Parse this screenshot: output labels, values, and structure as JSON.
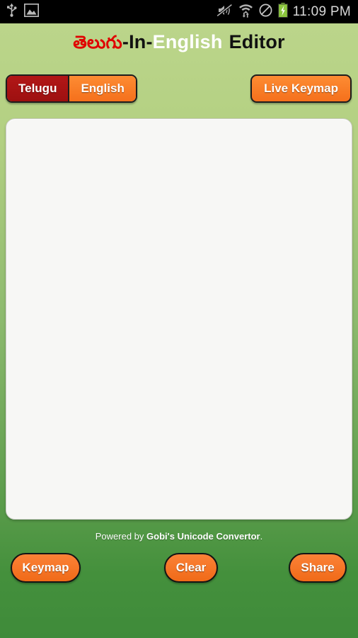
{
  "status_bar": {
    "icons_left": [
      "usb-icon",
      "screenshot-image-icon"
    ],
    "icons_right": [
      "mute-vibrate-icon",
      "wifi-data-transfer-icon",
      "do-not-disturb-icon",
      "battery-charging-icon"
    ],
    "time": "11:09 PM",
    "background": "#000000",
    "text_color": "#d8d8d8"
  },
  "app": {
    "title_parts": {
      "telugu": "తెలుగు",
      "dash_in": "-In-",
      "english": "English",
      "editor": "Editor"
    },
    "title_colors": {
      "telugu": "#e00000",
      "dash_in": "#111111",
      "english": "#ffffff",
      "editor": "#111111"
    }
  },
  "language_toggle": {
    "options": [
      "Telugu",
      "English"
    ],
    "selected": "Telugu",
    "selected_color": "#a81414",
    "unselected_color": "#f97d2a"
  },
  "live_keymap_button": {
    "label": "Live Keymap"
  },
  "editor": {
    "value": "",
    "placeholder": ""
  },
  "footer": {
    "credit_prefix": "Powered by ",
    "credit_name": "Gobi's Unicode Convertor",
    "credit_suffix": ".",
    "buttons": {
      "keymap": "Keymap",
      "clear": "Clear",
      "share": "Share"
    }
  },
  "theme": {
    "bg_top": "#bdd68c",
    "bg_bottom": "#3f8b3a",
    "accent_orange": "#f97d2a",
    "accent_red": "#a81414"
  }
}
